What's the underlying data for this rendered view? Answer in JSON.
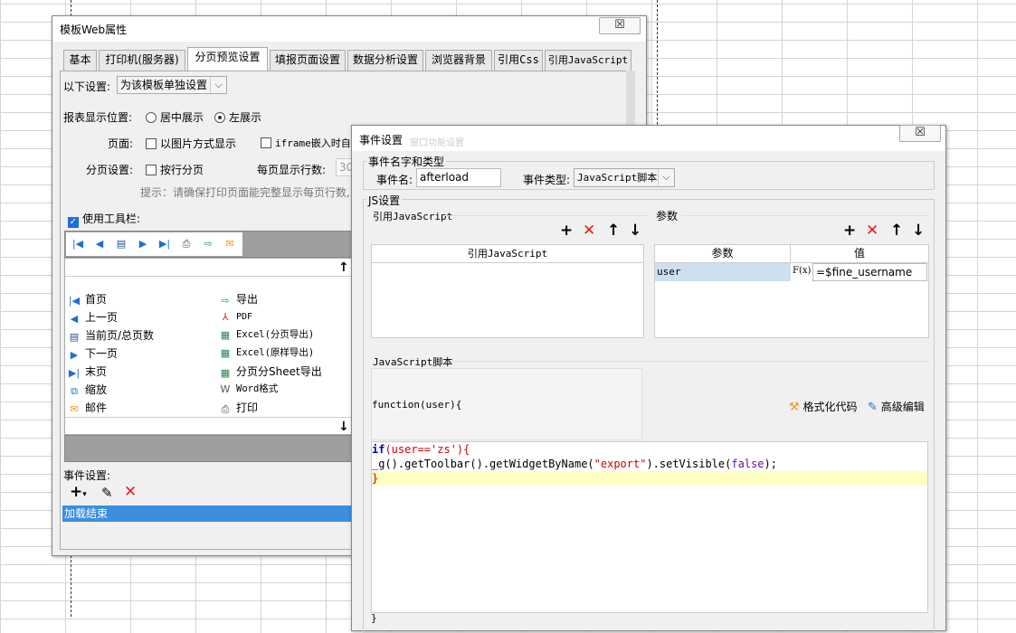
{
  "main_window": {
    "title": "模板Web属性",
    "close": "☒",
    "tabs": [
      "基本",
      "打印机(服务器)",
      "分页预览设置",
      "填报页面设置",
      "数据分析设置",
      "浏览器背景",
      "引用Css",
      "引用JavaScript"
    ],
    "settings_label": "以下设置:",
    "settings_value": "为该模板单独设置",
    "display_pos_label": "报表显示位置:",
    "radio_center": "居中展示",
    "radio_left": "左展示",
    "page_label": "页面:",
    "as_image": "以图片方式显示",
    "iframe": "iframe嵌入时自",
    "paging_label": "分页设置:",
    "by_row": "按行分页",
    "rows_per_page_label": "每页显示行数:",
    "rows_per_page_value": "30",
    "hint": "提示：请确保打印页面能完整显示每页行数,",
    "use_toolbar": "使用工具栏:",
    "buttons_left": [
      "首页",
      "上一页",
      "当前页/总页数",
      "下一页",
      "末页",
      "缩放",
      "邮件"
    ],
    "buttons_right": [
      "导出",
      "PDF",
      "Excel(分页导出)",
      "Excel(原样导出)",
      "分页分Sheet导出",
      "Word格式",
      "打印"
    ],
    "event_settings": "事件设置:",
    "event_item": "加载结束"
  },
  "event_window": {
    "title": "事件设置",
    "faded_title": "窗口功能设置",
    "group_name_type": "事件名字和类型",
    "event_name_label": "事件名:",
    "event_name_value": "afterload",
    "event_type_label": "事件类型:",
    "event_type_value": "JavaScript脚本",
    "js_settings": "JS设置",
    "ref_js_group": "引用JavaScript",
    "ref_js_col": "引用JavaScript",
    "params_group": "参数",
    "params_col_name": "参数",
    "params_col_value": "值",
    "param_name": "user",
    "param_fx": "F(x)",
    "param_value": "=$fine_username",
    "script_group": "JavaScript脚本",
    "function_sig": "function(user){",
    "format_code": "格式化代码",
    "advanced_edit": "高级编辑",
    "code_line1_kw": "if",
    "code_line1_rest": "(user=='zs'){",
    "code_line2_a": "_g().getToolbar().getWidgetByName(",
    "code_line2_str": "\"export\"",
    "code_line2_b": ").setVisible(",
    "code_line2_kw": "false",
    "code_line2_c": ");",
    "code_line3": "}",
    "closing_brace": "}"
  },
  "colors": {
    "accent": "#1d6fd6",
    "toolbar_gray": "#9e9e9e",
    "highlight_code": "#ffffc4",
    "param_cell": "#cde0ef",
    "delete_red": "#e02020"
  }
}
